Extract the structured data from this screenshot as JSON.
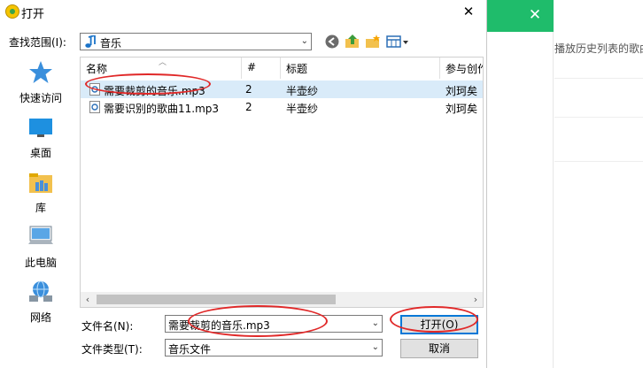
{
  "background_app": {
    "close_glyph": "✕",
    "history_text": "播放历史列表的歌曲"
  },
  "dialog": {
    "title": "打开",
    "close_glyph": "✕",
    "look_in_label": "查找范围(I):",
    "look_in_value": "音乐",
    "places": [
      {
        "label": "快速访问",
        "icon": "star-icon"
      },
      {
        "label": "桌面",
        "icon": "desktop-icon"
      },
      {
        "label": "库",
        "icon": "library-folder-icon"
      },
      {
        "label": "此电脑",
        "icon": "computer-icon"
      },
      {
        "label": "网络",
        "icon": "network-icon"
      }
    ],
    "columns": [
      "名称",
      "#",
      "标题",
      "参与创作"
    ],
    "files": [
      {
        "name": "需要裁剪的音乐.mp3",
        "num": "2",
        "title": "半壶纱",
        "artist": "刘珂矣"
      },
      {
        "name": "需要识别的歌曲11.mp3",
        "num": "2",
        "title": "半壶纱",
        "artist": "刘珂矣"
      }
    ],
    "filename_label": "文件名(N):",
    "filename_value": "需要裁剪的音乐.mp3",
    "filetype_label": "文件类型(T):",
    "filetype_value": "音乐文件",
    "open_button": "打开(O)",
    "cancel_button": "取消",
    "scroll_left": "‹",
    "scroll_right": "›",
    "dropdown_glyph": "⌄"
  },
  "colors": {
    "accent_green": "#1fbc6b",
    "selection": "#d9ebf9",
    "annotation_red": "#e02828",
    "default_button_border": "#0078d7"
  }
}
